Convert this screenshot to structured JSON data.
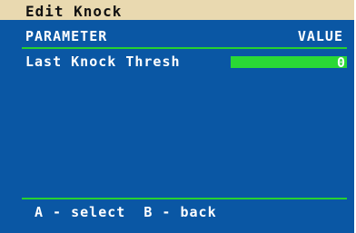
{
  "window": {
    "title": "Edit Knock"
  },
  "table": {
    "header_parameter": "PARAMETER",
    "header_value": "VALUE",
    "rows": [
      {
        "label": "Last Knock Thresh",
        "value": "0",
        "selected": true
      }
    ]
  },
  "footer": {
    "hint": "A - select  B - back"
  },
  "colors": {
    "background": "#0a57a4",
    "title_bar": "#e9d9b0",
    "accent_green": "#2ad935",
    "text": "#ffffff"
  }
}
